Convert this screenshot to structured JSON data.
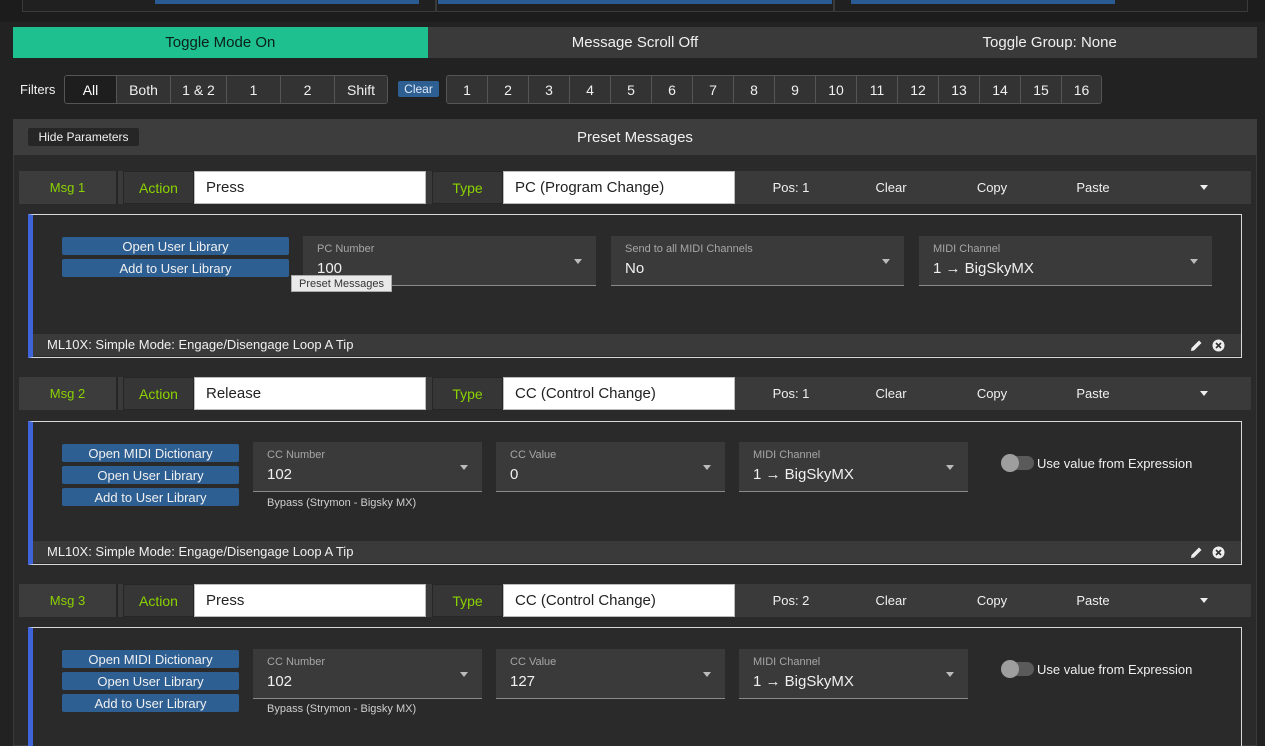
{
  "mode_bar": {
    "toggle_mode": "Toggle Mode On",
    "message_scroll": "Message Scroll Off",
    "toggle_group": "Toggle Group: None"
  },
  "filters": {
    "label": "Filters",
    "groups": [
      "All",
      "Both",
      "1 & 2",
      "1",
      "2",
      "Shift"
    ],
    "clear": "Clear",
    "channels": [
      "1",
      "2",
      "3",
      "4",
      "5",
      "6",
      "7",
      "8",
      "9",
      "10",
      "11",
      "12",
      "13",
      "14",
      "15",
      "16"
    ]
  },
  "panel": {
    "hide_params": "Hide Parameters",
    "title": "Preset Messages"
  },
  "common": {
    "action": "Action",
    "type": "Type",
    "clear": "Clear",
    "copy": "Copy",
    "paste": "Paste",
    "open_midi_dictionary": "Open MIDI Dictionary",
    "open_user_library": "Open User Library",
    "add_to_user_library": "Add to User Library",
    "use_expression": "Use value from Expression"
  },
  "messages": [
    {
      "tag": "Msg 1",
      "action": "Press",
      "type": "PC (Program Change)",
      "pos": "Pos: 1",
      "fields": [
        {
          "label": "PC Number",
          "value": "100"
        },
        {
          "label": "Send to all MIDI Channels",
          "value": "No"
        },
        {
          "label": "MIDI Channel",
          "value": "1 → BigSkyMX"
        }
      ],
      "tooltip": "Preset Messages",
      "footer": "ML10X: Simple Mode: Engage/Disengage Loop A Tip"
    },
    {
      "tag": "Msg 2",
      "action": "Release",
      "type": "CC (Control Change)",
      "pos": "Pos: 1",
      "fields": [
        {
          "label": "CC Number",
          "value": "102"
        },
        {
          "label": "CC Value",
          "value": "0"
        },
        {
          "label": "MIDI Channel",
          "value": "1 → BigSkyMX"
        }
      ],
      "sub": "Bypass (Strymon - Bigsky MX)",
      "footer": "ML10X: Simple Mode: Engage/Disengage Loop A Tip"
    },
    {
      "tag": "Msg 3",
      "action": "Press",
      "type": "CC (Control Change)",
      "pos": "Pos: 2",
      "fields": [
        {
          "label": "CC Number",
          "value": "102"
        },
        {
          "label": "CC Value",
          "value": "127"
        },
        {
          "label": "MIDI Channel",
          "value": "1 → BigSkyMX"
        }
      ],
      "sub": "Bypass (Strymon - Bigsky MX)"
    }
  ],
  "colors": {
    "accent_green": "#1dc08e",
    "label_green": "#8bd300",
    "button_blue": "#2e5f93",
    "block_border_blue": "#3f63d9"
  },
  "icons": [
    "pencil-icon",
    "close-circle-icon",
    "chevron-down-icon"
  ]
}
